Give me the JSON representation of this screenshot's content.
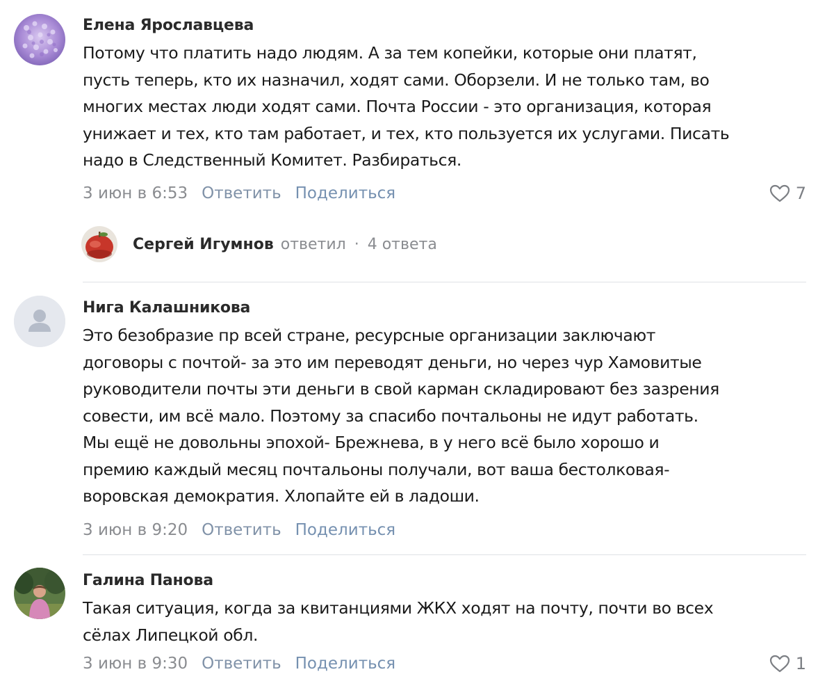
{
  "comments": [
    {
      "author": "Елена Ярославцева",
      "lines": [
        "Потому что платить надо людям. А за тем копейки, которые они платят,",
        "пусть теперь, кто их назначил, ходят сами. Оборзели. И не только там, во",
        "многих местах люди ходят сами. Почта России - это организация, которая",
        "унижает и тех, кто там работает, и тех, кто пользуется их услугами. Писать",
        "надо в Следственный Комитет. Разбираться."
      ],
      "date": "3 июн в 6:53",
      "reply_label": "Ответить",
      "share_label": "Поделиться",
      "likes": "7",
      "thread": {
        "replier": "Сергей Игумнов",
        "replied_label": "ответил",
        "separator": "·",
        "count_label": "4 ответа"
      }
    },
    {
      "author": "Нига Калашникова",
      "lines": [
        "Это безобразие пр всей стране, ресурсные организации заключают",
        "договоры с почтой- за это им переводят деньги, но через чур Хамовитые",
        "руководители почты эти деньги в свой карман складировают без зазрения",
        "совести, им всё мало. Поэтому за спасибо почтальоны не идут работать.",
        "Мы ещё не довольны эпохой- Брежнева, в у него всё было хорошо и",
        "премию каждый месяц почтальоны получали, вот ваша бестолковая-",
        "воровская демократия. Хлопайте ей в ладоши."
      ],
      "date": "3 июн в 9:20",
      "reply_label": "Ответить",
      "share_label": "Поделиться"
    },
    {
      "author": "Галина Панова",
      "lines": [
        "Такая ситуация, когда за квитанциями ЖКХ ходят на почту, почти во всех",
        "сёлах Липецкой обл."
      ],
      "date": "3 июн в 9:30",
      "reply_label": "Ответить",
      "share_label": "Поделиться",
      "likes": "1"
    }
  ],
  "icons": {
    "like": "heart-outline-icon",
    "default_avatar": "user-silhouette-icon"
  },
  "colors": {
    "link": "#5d7da3",
    "muted": "#8a8c90",
    "divider": "#dfe1e5"
  }
}
